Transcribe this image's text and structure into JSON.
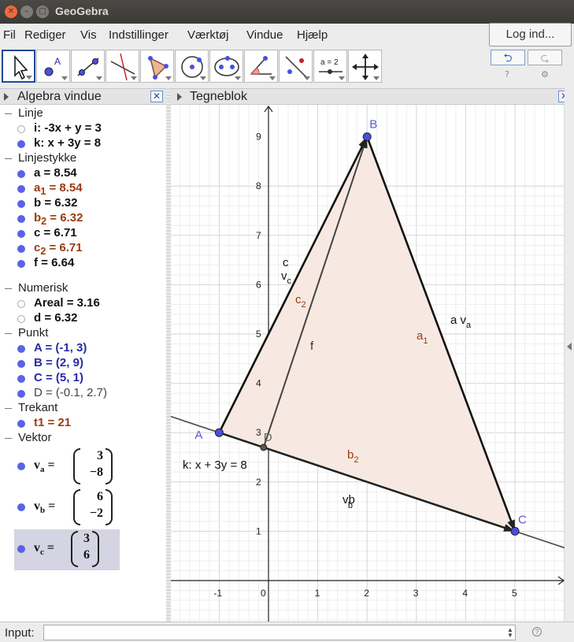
{
  "window": {
    "title": "GeoGebra"
  },
  "menu": [
    "Fil",
    "Rediger",
    "Vis",
    "Indstillinger",
    "Værktøj",
    "Vindue",
    "Hjælp"
  ],
  "login_label": "Log ind...",
  "toolbar": {
    "undo": "⮌",
    "redo": "⮎",
    "help": "?",
    "settings": "⚙",
    "slider_tool_label": "a = 2",
    "point_tool_label": "A"
  },
  "algebra": {
    "title": "Algebra vindue",
    "groups": [
      {
        "name": "Linje",
        "items": [
          {
            "text": "i: -3x + y = 3",
            "visible": false
          },
          {
            "text": "k: x + 3y = 8",
            "visible": true
          }
        ]
      },
      {
        "name": "Linjestykke",
        "items": [
          {
            "text": "a = 8.54"
          },
          {
            "label": "a",
            "sub": "1",
            "value": " = 8.54"
          },
          {
            "text": "b = 6.32"
          },
          {
            "label": "b",
            "sub": "2",
            "value": " = 6.32"
          },
          {
            "text": "c = 6.71"
          },
          {
            "label": "c",
            "sub": "2",
            "value": " = 6.71"
          },
          {
            "text": "f = 6.64"
          }
        ]
      },
      {
        "name": "Numerisk",
        "items": [
          {
            "text": "Areal = 3.16"
          },
          {
            "text": "d = 6.32"
          }
        ]
      },
      {
        "name": "Punkt",
        "items": [
          {
            "text": "A = (-1, 3)"
          },
          {
            "text": "B = (2, 9)"
          },
          {
            "text": "C = (5, 1)"
          },
          {
            "text": "D = (-0.1, 2.7)"
          }
        ]
      },
      {
        "name": "Trekant",
        "items": [
          {
            "text": "t1 = 21"
          }
        ]
      },
      {
        "name": "Vektor",
        "items": [
          {
            "label": "v",
            "sub": "a",
            "eq": "=",
            "x": "3",
            "y": "−8"
          },
          {
            "label": "v",
            "sub": "b",
            "eq": "=",
            "x": "6",
            "y": "−2"
          },
          {
            "label": "v",
            "sub": "c",
            "eq": "=",
            "x": "3",
            "y": "6"
          }
        ]
      }
    ]
  },
  "graphics": {
    "title": "Tegneblok",
    "x_ticks": [
      "-1",
      "0",
      "1",
      "2",
      "3",
      "4",
      "5"
    ],
    "y_ticks": [
      "1",
      "2",
      "3",
      "4",
      "5",
      "6",
      "7",
      "8",
      "9"
    ],
    "points": [
      {
        "name": "A",
        "x": -1,
        "y": 3
      },
      {
        "name": "B",
        "x": 2,
        "y": 9
      },
      {
        "name": "C",
        "x": 5,
        "y": 1
      },
      {
        "name": "D",
        "x": -0.1,
        "y": 2.7
      }
    ],
    "labels": {
      "line_k": "k: x + 3y = 8",
      "seg_a1": "a",
      "seg_a1_sub": "1",
      "seg_b2": "b",
      "seg_b2_sub": "2",
      "seg_c2": "c",
      "seg_c2_sub": "2",
      "seg_f": "f",
      "seg_c": "c",
      "vec_c": "v",
      "vec_c_sub": "c",
      "seg_a_va": "a v",
      "seg_a_va_sub": "a",
      "vec_b": "vb",
      "vec_b_sub": "b"
    },
    "colors": {
      "fill": "#f7e9e1",
      "fill_stroke": "#c8a08a",
      "point": "#4a4fe0",
      "label_blue": "#5a5ad6",
      "label_brown": "#993c10"
    }
  },
  "input": {
    "label": "Input:",
    "value": ""
  }
}
